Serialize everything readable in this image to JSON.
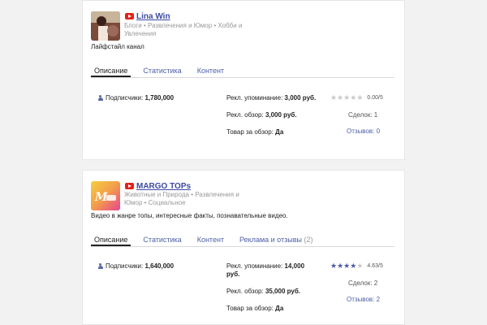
{
  "labels": {
    "subscribers": "Подписчики:",
    "mention": "Рекл. упоминание:",
    "review": "Рекл. обзор:",
    "product": "Товар за обзор:",
    "deals": "Сделок:",
    "reviews": "Отзывов:"
  },
  "channels": [
    {
      "name": "Lina Win",
      "categories": "Блоги • Развлечения и Юмор • Хобби и Увлечения",
      "description": "Лайфстайл канал",
      "tabs": [
        "Описание",
        "Статистика",
        "Контент"
      ],
      "subscribers": "1,780,000",
      "mention_price": "3,000 руб.",
      "review_price": "3,000 руб.",
      "product": "Да",
      "rating": 0.0,
      "rating_text": "0.00/5",
      "deals": "1",
      "reviews": "0"
    },
    {
      "name": "MARGO TOPs",
      "categories": "Животные и Природа • Развлечения и Юмор • Социальное",
      "description": "Видео в жанре топы, интересные факты, познавательные видео.",
      "tabs": [
        "Описание",
        "Статистика",
        "Контент",
        "Реклама и отзывы"
      ],
      "tab_extra_count": "(2)",
      "subscribers": "1,640,000",
      "mention_price": "14,000 руб.",
      "review_price": "35,000 руб.",
      "product": "Да",
      "rating": 4.63,
      "rating_text": "4.63/5",
      "deals": "2",
      "reviews": "2"
    }
  ],
  "colors": {
    "accent": "#3b4aa3",
    "youtube": "#e62117",
    "star_on": "#4c5ba8",
    "star_off": "#c9c9c9"
  },
  "icons": [
    "youtube-icon",
    "person-icon",
    "star-icon"
  ]
}
